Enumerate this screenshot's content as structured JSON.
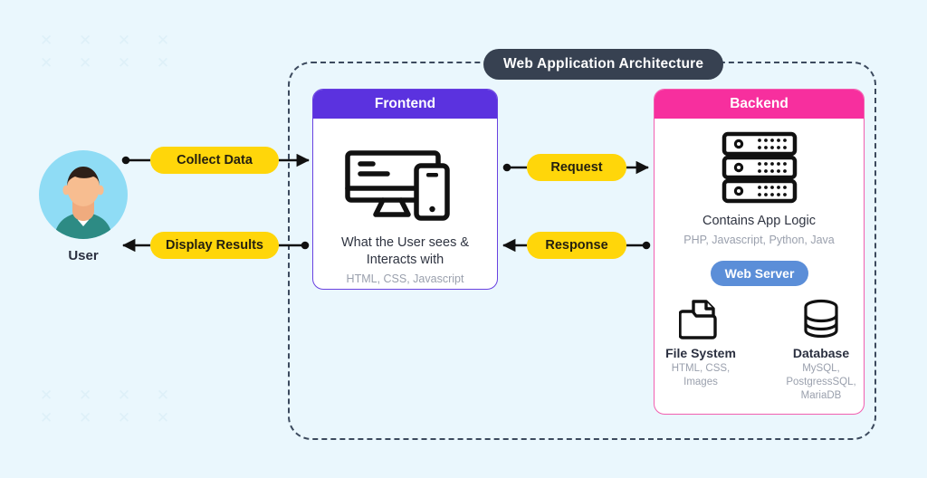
{
  "diagram": {
    "title": "Web Application Architecture",
    "background_color": "#eaf7fd",
    "boundary_style": "dashed"
  },
  "actor": {
    "label": "User",
    "icon": "user-avatar-icon",
    "avatar_bg": "#8fdcf5",
    "shirt_color": "#2d8b84",
    "hair_color": "#2e2018",
    "skin_color": "#f0ab7e"
  },
  "flows": {
    "collect_data": "Collect Data",
    "display_results": "Display Results",
    "request": "Request",
    "response": "Response",
    "pill_color": "#ffd60a"
  },
  "frontend": {
    "header": "Frontend",
    "header_color": "#5b32df",
    "icon": "monitor-and-phone-icon",
    "title": "What the User sees & Interacts with",
    "subtitle": "HTML, CSS, Javascript"
  },
  "backend": {
    "header": "Backend",
    "header_color": "#f72f9e",
    "icon": "server-rack-icon",
    "title": "Contains App Logic",
    "subtitle": "PHP, Javascript, Python, Java",
    "web_server": {
      "label": "Web Server",
      "color": "#5b8ed8"
    },
    "stores": [
      {
        "name": "File System",
        "icon": "folder-document-icon",
        "details": "HTML, CSS,\nImages",
        "details_line1": "HTML, CSS,",
        "details_line2": "Images"
      },
      {
        "name": "Database",
        "icon": "database-cylinder-icon",
        "details": "MySQL,\nPostgressSQL,\nMariaDB",
        "details_line1": "MySQL,",
        "details_line2": "PostgressSQL,",
        "details_line3": "MariaDB"
      }
    ]
  },
  "decoration": {
    "pattern_glyphs": "✕ ✕ ✕ ✕",
    "pattern_color": "#dceff8"
  }
}
